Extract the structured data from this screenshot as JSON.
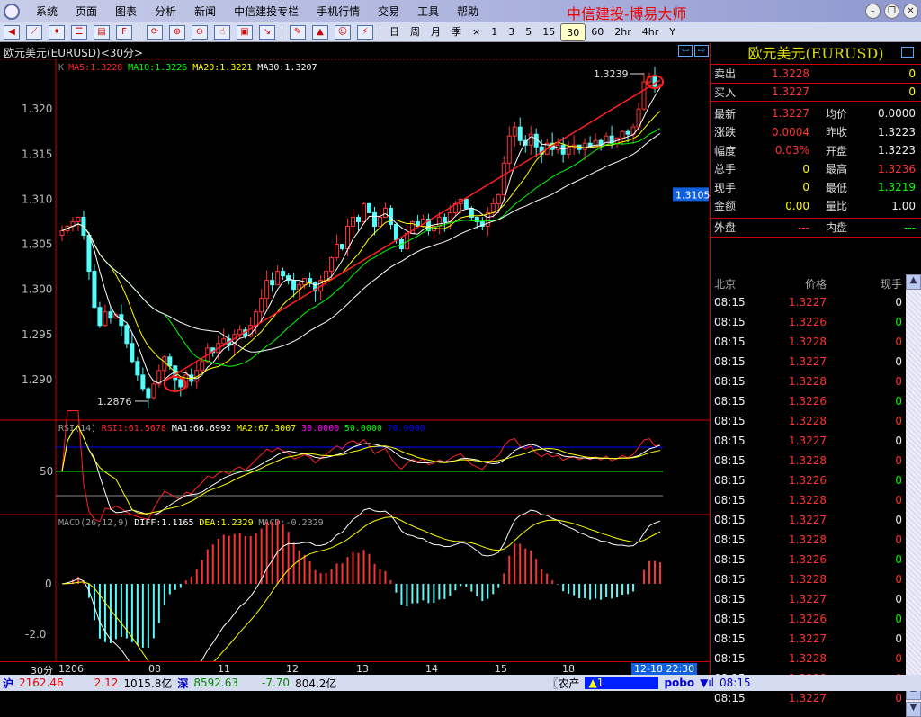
{
  "menu": {
    "items": [
      "系统",
      "页面",
      "图表",
      "分析",
      "新闻",
      "中信建投专栏",
      "手机行情",
      "交易",
      "工具",
      "帮助"
    ],
    "app_title": "中信建投-博易大师"
  },
  "toolbar": {
    "icons": [
      "back-icon",
      "line-chart-icon",
      "candle-chart-icon",
      "table-icon",
      "report-icon",
      "f10-icon",
      "refresh-icon",
      "zoom-in-icon",
      "zoom-out-icon",
      "hand-icon",
      "window-icon",
      "export-icon",
      "draw-icon",
      "alarm-icon",
      "users-icon",
      "lightning-icon"
    ],
    "periods": [
      "日",
      "周",
      "月",
      "季",
      "×",
      "1",
      "3",
      "5",
      "15",
      "30",
      "60",
      "2hr",
      "4hr",
      "Y"
    ],
    "active_period": "30"
  },
  "chart": {
    "title": "欧元美元(EURUSD)<30分>",
    "ma_legend": {
      "k": "K",
      "ma5": "MA5:1.3228",
      "ma10": "MA10:1.3226",
      "ma20": "MA20:1.3221",
      "ma30": "MA30:1.3207"
    },
    "rsi_legend": {
      "name": "RSI(14)",
      "rsi1": "RSI1:61.5678",
      "ma1": "MA1:66.6992",
      "ma2": "MA2:67.3007",
      "l30": "30.0000",
      "l50": "50.0000",
      "l70": "70.0000"
    },
    "macd_legend": {
      "name": "MACD(26,12,9)",
      "diff": "DIFF:1.1165",
      "dea": "DEA:1.2329",
      "macd": "MACD:-0.2329"
    },
    "high_label": "1.3239",
    "low_label": "1.2876",
    "price_tag": "1.3105",
    "period_label": "30分",
    "cursor_time": "12-18 22:30",
    "colors": {
      "up": "#ff3232",
      "down": "#54fcfc",
      "ma5": "#ffffff",
      "ma10": "#ffff00",
      "ma20": "#00ff00",
      "ma30": "#ffffff",
      "trend": "#ff2020"
    }
  },
  "chart_data": {
    "type": "candlestick",
    "price_axis": {
      "ticks": [
        "1.320",
        "1.315",
        "1.310",
        "1.305",
        "1.300",
        "1.295",
        "1.290"
      ],
      "range": [
        1.2855,
        1.3255
      ]
    },
    "x_labels": [
      "1206",
      "08",
      "11",
      "12",
      "13",
      "14",
      "15",
      "18"
    ],
    "closes": [
      1.3065,
      1.307,
      1.3075,
      1.308,
      1.306,
      1.302,
      1.298,
      1.296,
      1.2975,
      1.2968,
      1.2972,
      1.296,
      1.294,
      1.292,
      1.2905,
      1.289,
      1.288,
      1.2895,
      1.291,
      1.2925,
      1.2915,
      1.29,
      1.2892,
      1.2905,
      1.2898,
      1.291,
      1.292,
      1.2935,
      1.293,
      1.294,
      1.2945,
      1.2938,
      1.295,
      1.2955,
      1.2948,
      1.296,
      1.2975,
      1.299,
      1.301,
      1.3005,
      1.302,
      1.3015,
      1.301,
      1.3,
      1.3005,
      1.3012,
      1.3008,
      1.2998,
      1.301,
      1.302,
      1.3035,
      1.305,
      1.3045,
      1.307,
      1.308,
      1.3075,
      1.3095,
      1.3085,
      1.307,
      1.308,
      1.309,
      1.3072,
      1.3055,
      1.3045,
      1.3062,
      1.3075,
      1.307,
      1.3078,
      1.3065,
      1.307,
      1.308,
      1.3075,
      1.3085,
      1.3095,
      1.31,
      1.309,
      1.308,
      1.3075,
      1.307,
      1.3085,
      1.3095,
      1.3105,
      1.314,
      1.317,
      1.318,
      1.3165,
      1.316,
      1.3172,
      1.3158,
      1.315,
      1.3162,
      1.3155,
      1.316,
      1.315,
      1.3158,
      1.316,
      1.3155,
      1.3162,
      1.3158,
      1.3165,
      1.316,
      1.317,
      1.3162,
      1.3168,
      1.3175,
      1.3172,
      1.318,
      1.32,
      1.323,
      1.3236,
      1.3225,
      1.3227
    ],
    "rsi_axis": {
      "ticks": [
        "50"
      ],
      "lines": [
        30,
        50,
        70
      ]
    },
    "macd_axis": {
      "ticks": [
        "0",
        "-2.0"
      ]
    }
  },
  "quote": {
    "title": "欧元美元(EURUSD)",
    "sell": {
      "label": "卖出",
      "price": "1.3228",
      "vol": "0"
    },
    "buy": {
      "label": "买入",
      "price": "1.3227",
      "vol": "0"
    },
    "rows": [
      {
        "l1": "最新",
        "v1": "1.3227",
        "c1": "red",
        "l2": "均价",
        "v2": "0.0000",
        "c2": "white"
      },
      {
        "l1": "涨跌",
        "v1": "0.0004",
        "c1": "red",
        "l2": "昨收",
        "v2": "1.3223",
        "c2": "white"
      },
      {
        "l1": "幅度",
        "v1": "0.03%",
        "c1": "red",
        "l2": "开盘",
        "v2": "1.3223",
        "c2": "white"
      },
      {
        "l1": "总手",
        "v1": "0",
        "c1": "yellow",
        "l2": "最高",
        "v2": "1.3236",
        "c2": "red"
      },
      {
        "l1": "现手",
        "v1": "0",
        "c1": "yellow",
        "l2": "最低",
        "v2": "1.3219",
        "c2": "green"
      },
      {
        "l1": "金额",
        "v1": "0.00",
        "c1": "yellow",
        "l2": "量比",
        "v2": "1.00",
        "c2": "white"
      }
    ],
    "outer": {
      "l1": "外盘",
      "v1": "---",
      "l2": "内盘",
      "v2": "---"
    }
  },
  "ticks": {
    "headers": [
      "北京",
      "价格",
      "现手"
    ],
    "rows": [
      [
        "08:15",
        "1.3227",
        "0",
        "white"
      ],
      [
        "08:15",
        "1.3226",
        "0",
        "green"
      ],
      [
        "08:15",
        "1.3228",
        "0",
        "red"
      ],
      [
        "08:15",
        "1.3227",
        "0",
        "white"
      ],
      [
        "08:15",
        "1.3228",
        "0",
        "red"
      ],
      [
        "08:15",
        "1.3226",
        "0",
        "green"
      ],
      [
        "08:15",
        "1.3228",
        "0",
        "red"
      ],
      [
        "08:15",
        "1.3227",
        "0",
        "white"
      ],
      [
        "08:15",
        "1.3228",
        "0",
        "red"
      ],
      [
        "08:15",
        "1.3226",
        "0",
        "green"
      ],
      [
        "08:15",
        "1.3228",
        "0",
        "red"
      ],
      [
        "08:15",
        "1.3227",
        "0",
        "white"
      ],
      [
        "08:15",
        "1.3228",
        "0",
        "red"
      ],
      [
        "08:15",
        "1.3226",
        "0",
        "green"
      ],
      [
        "08:15",
        "1.3228",
        "0",
        "red"
      ],
      [
        "08:15",
        "1.3227",
        "0",
        "white"
      ],
      [
        "08:15",
        "1.3226",
        "0",
        "green"
      ],
      [
        "08:15",
        "1.3227",
        "0",
        "white"
      ],
      [
        "08:15",
        "1.3228",
        "0",
        "red"
      ],
      [
        "08:15",
        "1.3228",
        "0",
        "red"
      ],
      [
        "08:15",
        "1.3227",
        "0",
        "red"
      ]
    ]
  },
  "status": {
    "sh_label": "沪",
    "sh_index": "2162.46",
    "sh_change": "2.12",
    "sh_amount": "1015.8亿",
    "sz_label": "深",
    "sz_index": "8592.63",
    "sz_change": "-7.70",
    "sz_amount": "804.2亿",
    "ticker": "〖农产",
    "alert": "▲1",
    "brand": "pobo",
    "time": "08:15"
  }
}
